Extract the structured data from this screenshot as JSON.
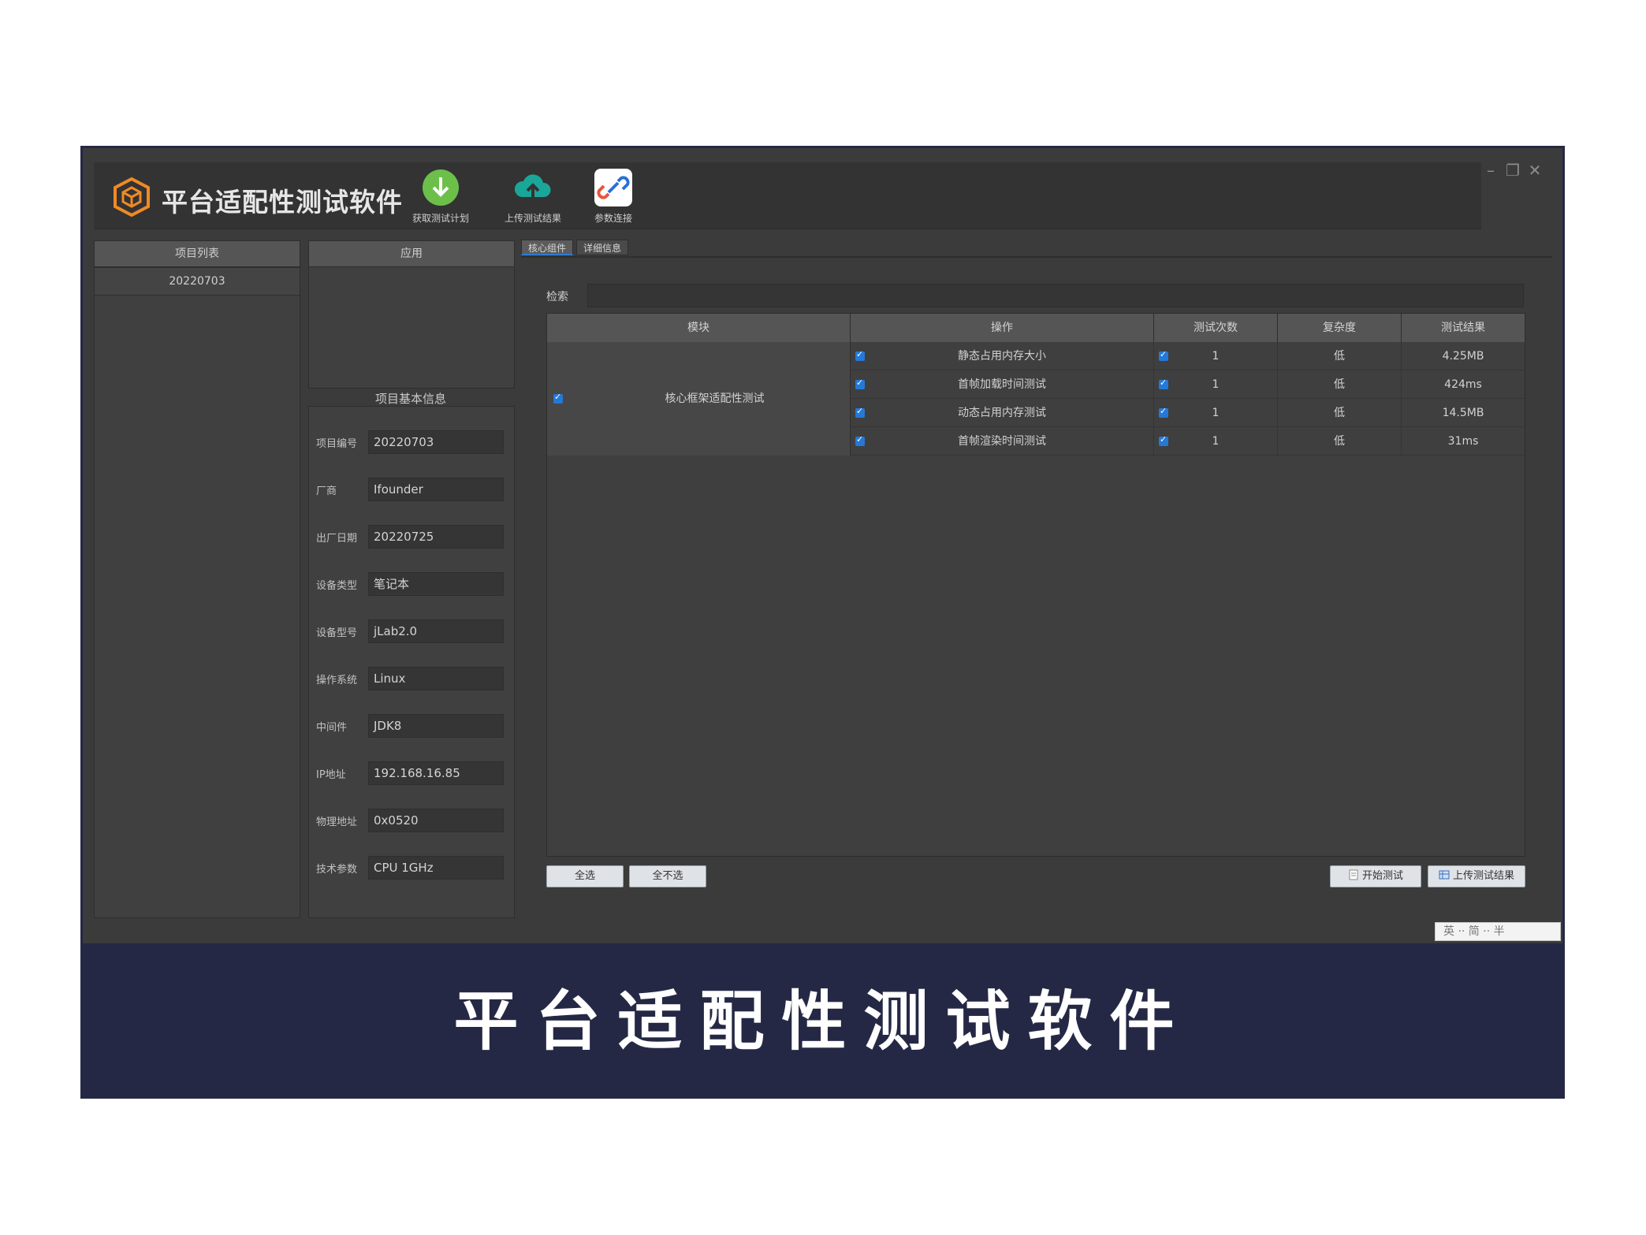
{
  "app": {
    "title": "平台适配性测试软件",
    "toolbar": [
      {
        "label": "获取测试计划",
        "icon": "download-icon"
      },
      {
        "label": "上传测试结果",
        "icon": "cloud-upload-icon"
      },
      {
        "label": "参数连接",
        "icon": "link-icon"
      }
    ],
    "window_controls": {
      "minimize": "–",
      "restore": "❐",
      "close": "✕"
    }
  },
  "left_panel": {
    "header": "项目列表",
    "items": [
      "20220703"
    ]
  },
  "middle_panel": {
    "header": "应用",
    "info_title": "项目基本信息",
    "fields": [
      {
        "key": "项目编号",
        "value": "20220703"
      },
      {
        "key": "厂商",
        "value": "Ifounder"
      },
      {
        "key": "出厂日期",
        "value": "20220725"
      },
      {
        "key": "设备类型",
        "value": "笔记本"
      },
      {
        "key": "设备型号",
        "value": "jLab2.0"
      },
      {
        "key": "操作系统",
        "value": "Linux"
      },
      {
        "key": "中间件",
        "value": "JDK8"
      },
      {
        "key": "IP地址",
        "value": "192.168.16.85"
      },
      {
        "key": "物理地址",
        "value": "0x0520"
      },
      {
        "key": "技术参数",
        "value": "CPU 1GHz"
      }
    ]
  },
  "tabs": [
    {
      "label": "核心组件",
      "active": true
    },
    {
      "label": "详细信息",
      "active": false
    }
  ],
  "search": {
    "label": "检索",
    "value": ""
  },
  "table": {
    "headers": [
      "模块",
      "操作",
      "测试次数",
      "复杂度",
      "测试结果"
    ],
    "group_name": "核心框架适配性测试",
    "rows": [
      {
        "op": "静态占用内存大小",
        "count": "1",
        "complexity": "低",
        "result": "4.25MB"
      },
      {
        "op": "首帧加载时间测试",
        "count": "1",
        "complexity": "低",
        "result": "424ms"
      },
      {
        "op": "动态占用内存测试",
        "count": "1",
        "complexity": "低",
        "result": "14.5MB"
      },
      {
        "op": "首帧渲染时间测试",
        "count": "1",
        "complexity": "低",
        "result": "31ms"
      }
    ]
  },
  "buttons": {
    "select_all": "全选",
    "select_none": "全不选",
    "start_test": "开始测试",
    "upload_result": "上传测试结果"
  },
  "status": {
    "language": "英 ·· 简 ·· 半"
  },
  "banner": {
    "text": "平台适配性测试软件"
  },
  "colors": {
    "frame": "#252845",
    "accent": "#f08a24",
    "checkbox": "#2479d8"
  }
}
